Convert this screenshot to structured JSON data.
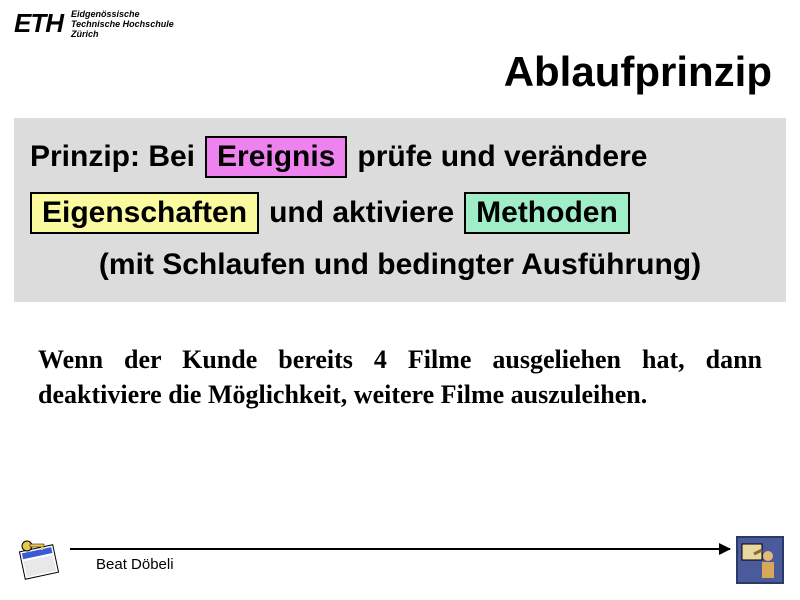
{
  "header": {
    "logo": "ETH",
    "logo_sub_line1": "Eidgenössische",
    "logo_sub_line2": "Technische Hochschule",
    "logo_sub_line3": "Zürich"
  },
  "title": "Ablaufprinzip",
  "principle": {
    "line1_prefix": "Prinzip: Bei",
    "ereignis": "Ereignis",
    "line1_suffix": "prüfe und verändere",
    "eigenschaften": "Eigenschaften",
    "line2_mid": "und aktiviere",
    "methoden": "Methoden",
    "line3": "(mit Schlaufen und bedingter Ausführung)"
  },
  "example_text": "Wenn der Kunde bereits 4 Filme ausgeliehen hat, dann deaktiviere die Möglichkeit, weitere Filme auszuleihen.",
  "footer": {
    "author": "Beat Döbeli"
  }
}
